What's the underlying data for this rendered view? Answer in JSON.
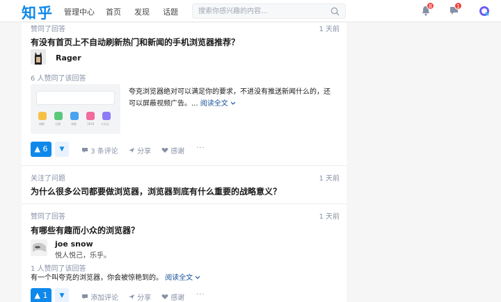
{
  "header": {
    "logo": "知乎",
    "nav": [
      "管理中心",
      "首页",
      "发现",
      "话题"
    ],
    "search_placeholder": "搜索你感兴趣的内容...",
    "notifications_badge": "8",
    "messages_badge": "1",
    "accent_color": "#0f88eb"
  },
  "feed": [
    {
      "action": "赞同了回答",
      "time": "1 天前",
      "question": "有没有首页上不自动刷新热门和新闻的手机浏览器推荐？",
      "author": "Rager",
      "votes_meta": "6 人赞同了该回答",
      "excerpt_line1": "夸克浏览器绝对可以满足你的要求，不进没有推送新闻什么的，还",
      "excerpt_line2": "可以屏蔽视频广告。...",
      "read_more": "阅读全文",
      "upvotes": "6",
      "comments": "3 条评论",
      "share": "分享",
      "thanks": "感谢",
      "more": "···"
    },
    {
      "action": "关注了问题",
      "time": "1 天前",
      "question": "为什么很多公司都要做浏览器，浏览器到底有什么重要的战略意义？"
    },
    {
      "action": "赞同了回答",
      "time": "1 天前",
      "question": "有哪些有趣而小众的浏览器？",
      "author": "joe snow",
      "bio": "悦人悦己，乐乎。",
      "votes_meta": "1 人赞同了该回答",
      "excerpt_line1": "有一个叫夸克的浏览器，你会被惊艳到的。",
      "read_more": "阅读全文",
      "upvotes": "1",
      "comments": "添加评论",
      "share": "分享",
      "thanks": "感谢",
      "more": "···"
    }
  ],
  "thumb_apps": [
    "电影",
    "订阅",
    "导航",
    "1818",
    "二次元"
  ]
}
